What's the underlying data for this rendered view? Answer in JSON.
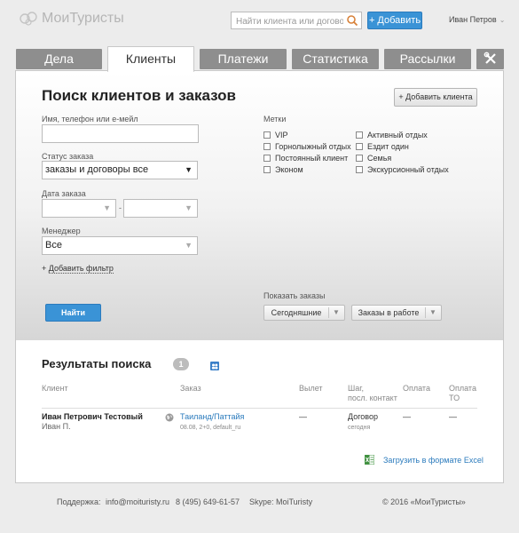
{
  "header": {
    "logo_text": "МоиТуристы",
    "search_placeholder": "Найти клиента или договор",
    "add_button": "+ Добавить",
    "user_name": "Иван Петров"
  },
  "tabs": [
    {
      "label": "Дела",
      "active": false
    },
    {
      "label": "Клиенты",
      "active": true
    },
    {
      "label": "Платежи",
      "active": false
    },
    {
      "label": "Статистика",
      "active": false
    },
    {
      "label": "Рассылки",
      "active": false
    },
    {
      "label": "tools-icon",
      "active": false
    }
  ],
  "search": {
    "title": "Поиск клиентов и заказов",
    "add_client_button": "+ Добавить клиента",
    "name_label": "Имя, телефон или е-мейл",
    "name_value": "",
    "status_label": "Статус заказа",
    "status_value": "заказы и договоры все",
    "date_label": "Дата заказа",
    "date_separator": "-",
    "manager_label": "Менеджер",
    "manager_value": "Все",
    "add_filter_plus": "+",
    "add_filter": "Добавить фильтр",
    "find_button": "Найти",
    "tags_label": "Метки",
    "tags_col1": [
      "VIP",
      "Горнолыжный отдых",
      "Постоянный клиент",
      "Эконом"
    ],
    "tags_col2": [
      "Активный отдых",
      "Ездит один",
      "Семья",
      "Экскурсионный отдых"
    ],
    "show_orders_label": "Показать заказы",
    "show_today": "Сегодняшние",
    "show_in_work": "Заказы в работе"
  },
  "results": {
    "title": "Результаты поиска",
    "count": "1",
    "columns": {
      "client": "Клиент",
      "order": "Заказ",
      "departure": "Вылет",
      "step_line1": "Шаг,",
      "step_line2": "посл. контакт",
      "payment": "Оплата",
      "payment_to_line1": "Оплата",
      "payment_to_line2": "ТО"
    },
    "rows": [
      {
        "client_name": "Иван Петрович Тестовый",
        "client_short": "Иван П.",
        "order_title": "Таиланд/Паттайя",
        "order_details": "08.08, 2+0, default_ru",
        "departure": "—",
        "step": "Договор",
        "step_date": "сегодня",
        "payment": "—",
        "payment_to": "—"
      }
    ],
    "excel_link": "Загрузить в формате Excel"
  },
  "footer": {
    "support_label": "Поддержка:",
    "email": "info@moituristy.ru",
    "phone": "8 (495) 649-61-57",
    "skype": "Skype: MoiTuristy",
    "copyright": "© 2016 «МоиТуристы»"
  },
  "colors": {
    "accent": "#3a93d6",
    "tab_inactive": "#8e8e8e",
    "link": "#2b7bbd"
  }
}
